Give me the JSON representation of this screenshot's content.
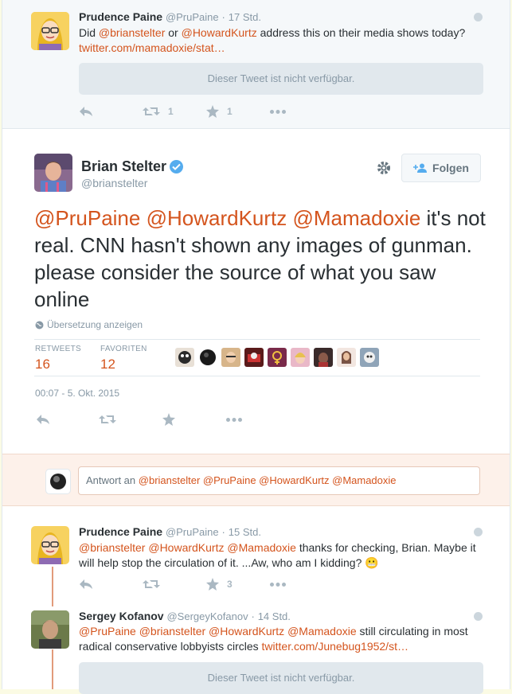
{
  "top_tweet": {
    "name": "Prudence Paine",
    "handle": "@PruPaine",
    "sep": "·",
    "time": "17 Std.",
    "text_pre": "Did ",
    "mention1": "@brianstelter",
    "text_mid": " or ",
    "mention2": "@HowardKurtz",
    "text_post": " address this on their media shows today?",
    "link": "twitter.com/mamadoxie/stat…",
    "unavailable": "Dieser Tweet ist nicht verfügbar.",
    "retweets": "1",
    "favorites": "1"
  },
  "main_tweet": {
    "name": "Brian Stelter",
    "handle": "@brianstelter",
    "follow_label": "Folgen",
    "mention1": "@PruPaine",
    "mention2": "@HowardKurtz",
    "mention3": "@Mamadoxie",
    "body": "it's not real. CNN hasn't shown any images of gunman. please consider the source of what you saw online",
    "translate": "Übersetzung anzeigen",
    "retweets_label": "RETWEETS",
    "retweets_value": "16",
    "favorites_label": "FAVORITEN",
    "favorites_value": "12",
    "date": "00:07 - 5. Okt. 2015"
  },
  "reply": {
    "prefix": "Antwort an ",
    "mentions": "@brianstelter @PruPaine @HowardKurtz @Mamadoxie"
  },
  "reply_tweet_1": {
    "name": "Prudence Paine",
    "handle": "@PruPaine",
    "sep": "·",
    "time": "15 Std.",
    "mentions": "@brianstelter @HowardKurtz @Mamadoxie",
    "text1": " thanks for checking, Brian. Maybe it",
    "text2": "will help stop the circulation of it. ...Aw, who am I kidding? 😬",
    "favorites": "3"
  },
  "reply_tweet_2": {
    "name": "Sergey Kofanov",
    "handle": "@SergeyKofanov",
    "sep": "·",
    "time": "14 Std.",
    "mentions": "@PruPaine @brianstelter @HowardKurtz @Mamadoxie",
    "text1": " still circulating in most",
    "text2": "radical conservative lobbyists circles ",
    "link": "twitter.com/Junebug1952/st…",
    "unavailable": "Dieser Tweet ist nicht verfügbar."
  },
  "colors": {
    "accent": "#d4541d",
    "muted": "#8899a6",
    "verified": "#55acee"
  }
}
